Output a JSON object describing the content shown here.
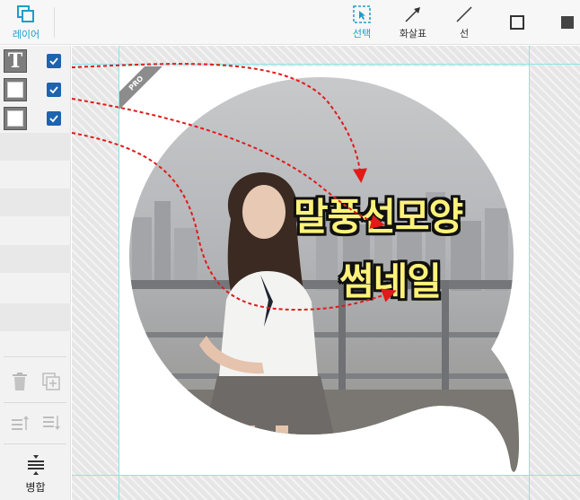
{
  "toolbar": {
    "layers_label": "레이어",
    "select_label": "선택",
    "arrow_label": "화살표",
    "line_label": "선"
  },
  "layers_panel": {
    "layers": [
      {
        "type": "text",
        "letter": "T",
        "checked": true
      },
      {
        "type": "shape",
        "letter": "",
        "checked": true
      },
      {
        "type": "shape",
        "letter": "",
        "checked": true
      }
    ],
    "merge_label": "병합"
  },
  "canvas": {
    "badge": "PRO",
    "title_line1": "말풍선모양",
    "title_line2": "썸네일"
  },
  "colors": {
    "accent": "#1a9ec8",
    "checkbox": "#1e63ad",
    "annotation_arrow": "#e21a1a",
    "title_fill": "#fff27a",
    "guide": "#8fe2ec"
  }
}
